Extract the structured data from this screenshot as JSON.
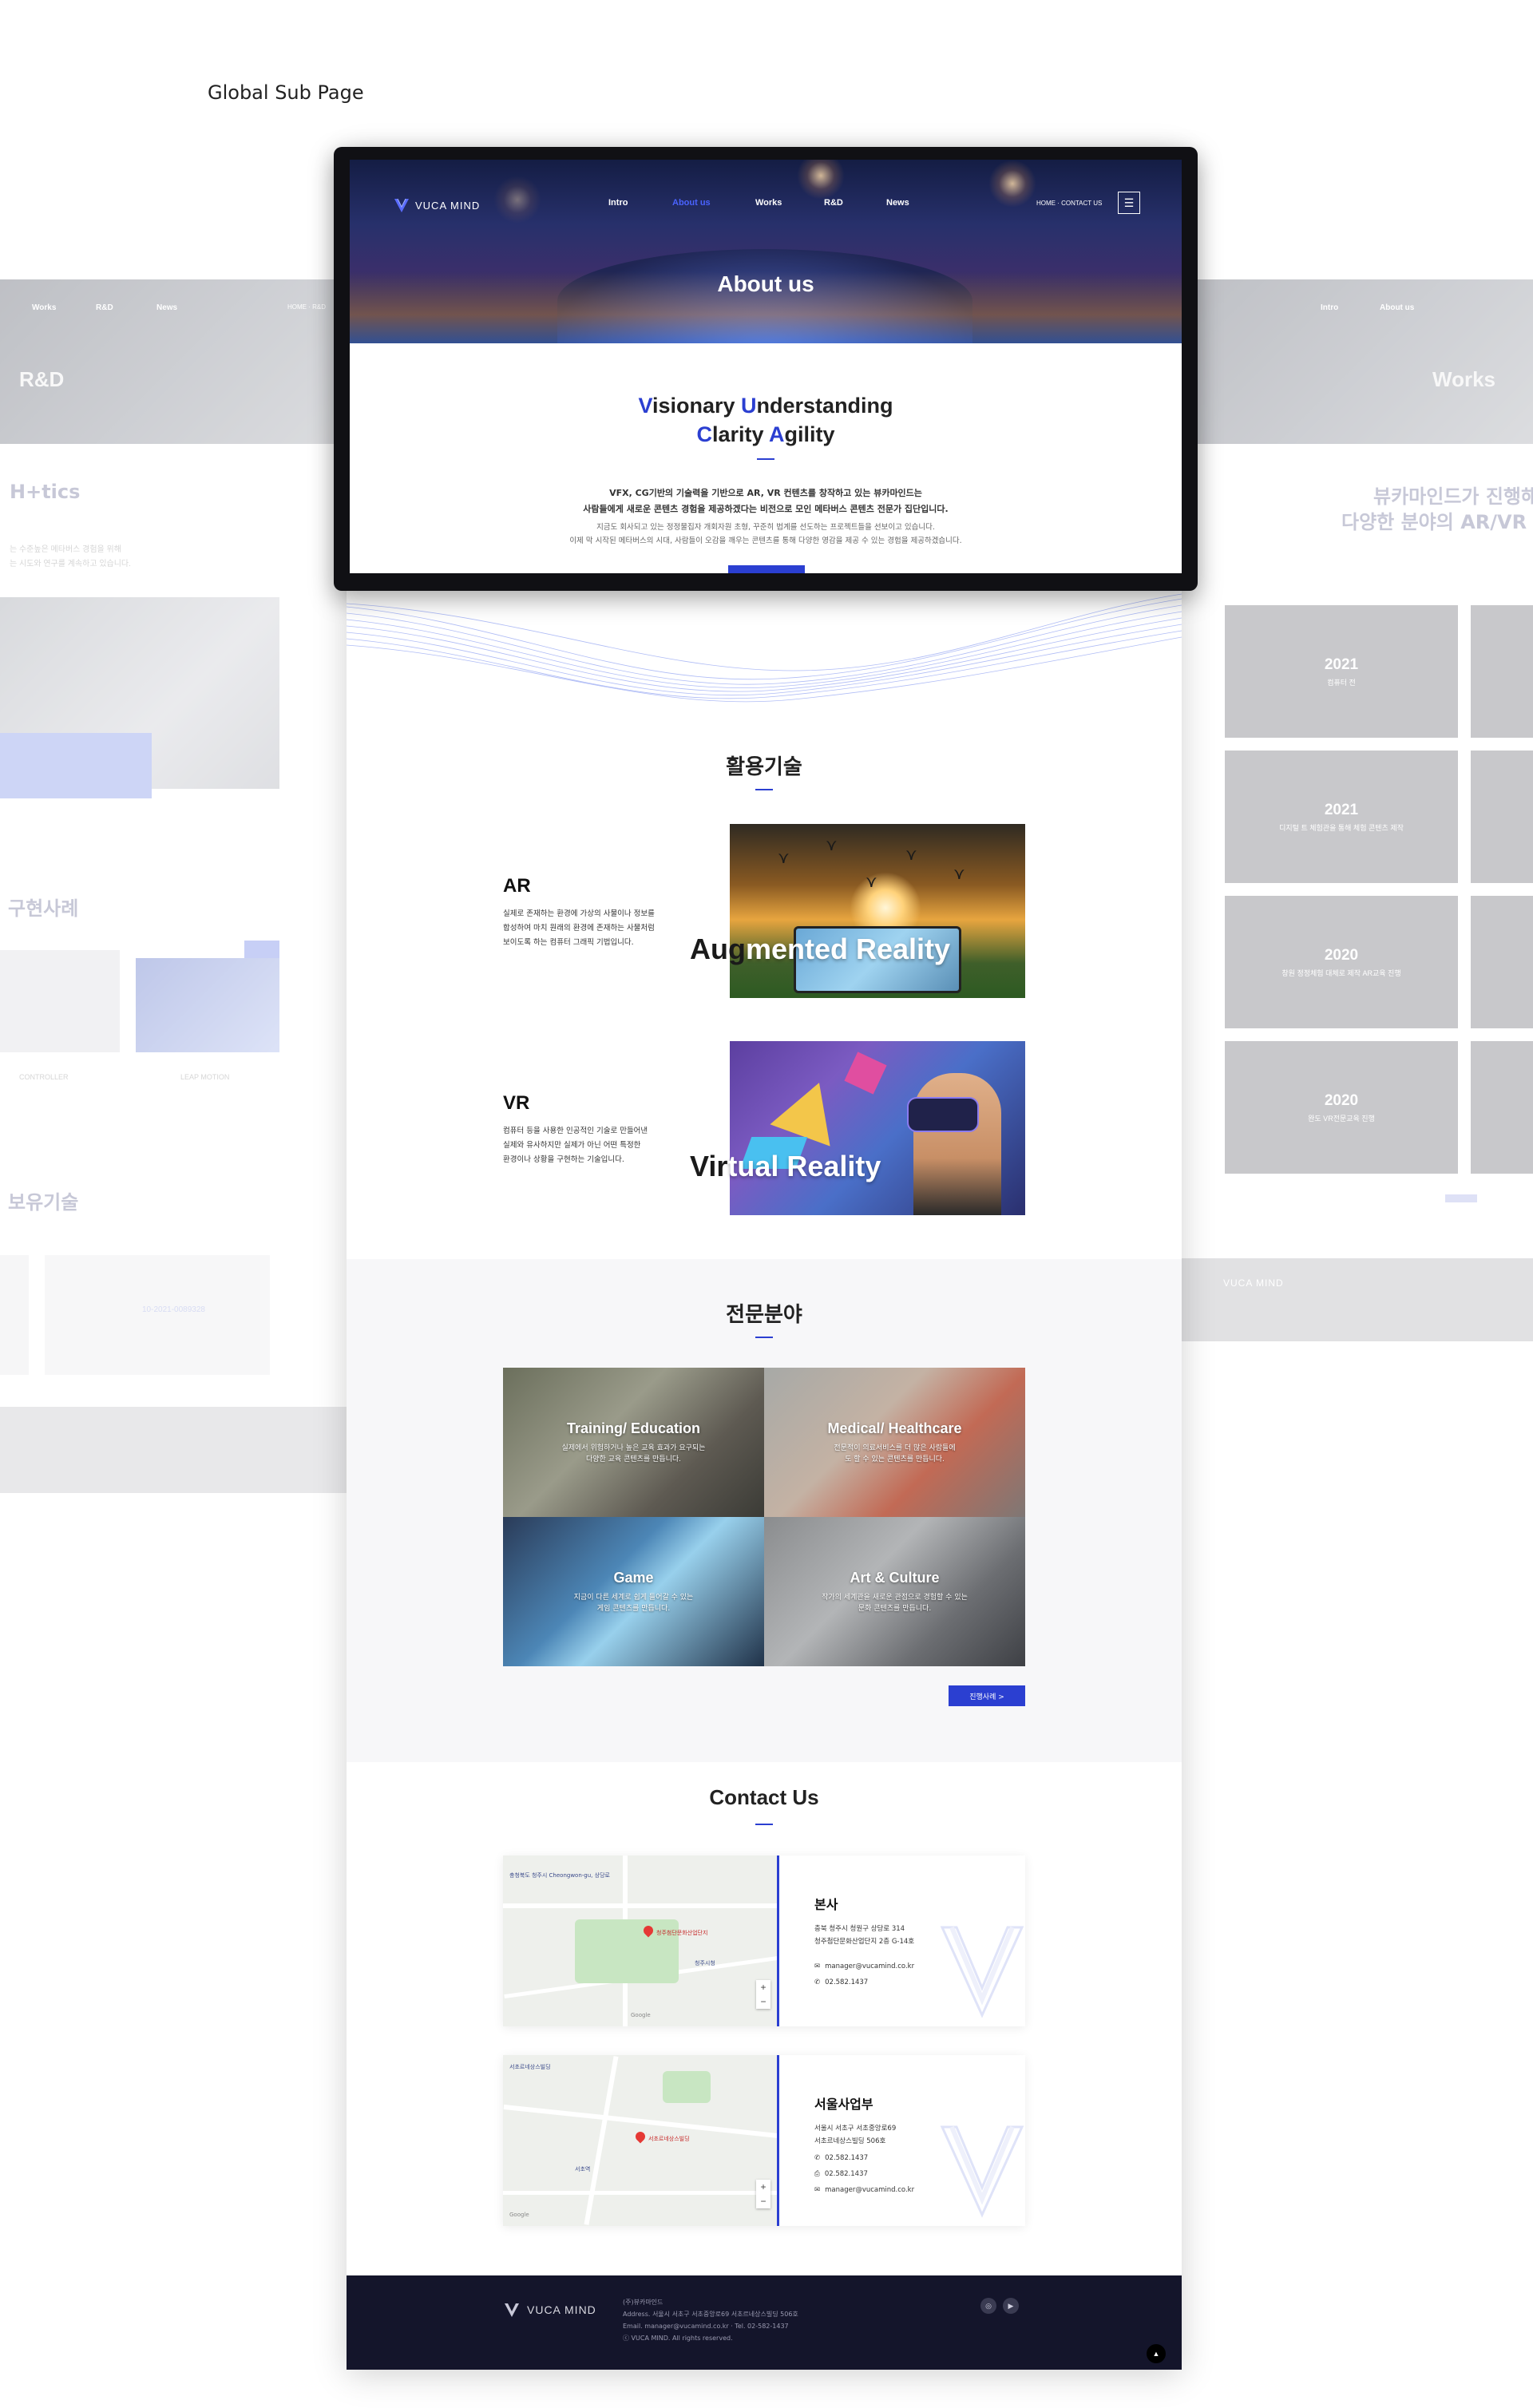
{
  "caption": "Global Sub Page",
  "header": {
    "logo_text": "VUCA MIND",
    "nav": [
      "Intro",
      "About us",
      "Works",
      "R&D",
      "News"
    ],
    "active_nav": "About us",
    "breadcrumb": "HOME · CONTACT US",
    "menu_icon": "hamburger-icon",
    "title": "About us"
  },
  "about": {
    "slogan_line1": [
      "V",
      "isionary ",
      "U",
      "nderstanding"
    ],
    "slogan_line2": [
      "C",
      "larity ",
      "A",
      "gility"
    ],
    "intro_bold": [
      "VFX, CG기반의 기술력을 기반으로 AR, VR 컨텐츠를 창작하고 있는 뷰카마인드는",
      "사람들에게 새로운 콘텐츠 경험을 제공하겠다는 비전으로 모인 메타버스 콘텐츠 전문가 집단입니다."
    ],
    "intro_light": [
      "지금도 회사되고 있는 정정물집자 개회자원 초형, 꾸준히 법계를 선도하는 프로젝트들을 선보이고 있습니다.",
      "이제 막 시작된 메타버스의 시대, 사람들이 오감을 깨우는 콘텐츠를 통해 다양한 영감을 제공 수 있는 경험을 제공하겠습니다."
    ]
  },
  "technology": {
    "title": "활용기술",
    "items": [
      {
        "name": "AR",
        "desc": [
          "실제로 존재하는 환경에 가상의 사물이나 정보를",
          "합성하여 마치 원래의 환경에 존재하는 사물처럼",
          "보이도록 하는 컴퓨터 그래픽 기법입니다."
        ],
        "overlay_dark": "Aug",
        "overlay_light": "mented Reality"
      },
      {
        "name": "VR",
        "desc": [
          "컴퓨터 등을 사용한 인공적인 기술로 만들어낸",
          "실제와 유사하지만 실제가 아닌 어떤 특정한",
          "환경이나 상황을 구현하는 기술입니다."
        ],
        "overlay_dark": "Vir",
        "overlay_light": "tual Reality"
      }
    ]
  },
  "specialty": {
    "title": "전문분야",
    "tiles": [
      {
        "title": "Training/ Education",
        "desc": [
          "실제에서 위험하거나 높은 교육 효과가 요구되는",
          "다양한 교육 콘텐츠를 만듭니다."
        ]
      },
      {
        "title": "Medical/ Healthcare",
        "desc": [
          "전문적이 의료서비스를 더 많은 사람들에",
          "도 할 수 있는 콘텐츠를 만듭니다."
        ]
      },
      {
        "title": "Game",
        "desc": [
          "지금이 다른 세계로 쉽게 들어갈 수 있는",
          "게임 콘텐츠를 만듭니다."
        ]
      },
      {
        "title": "Art & Culture",
        "desc": [
          "작가의 세계관을 새로운 관점으로 경험할 수 있는",
          "문화 콘텐츠를 만듭니다."
        ]
      }
    ],
    "more_label": "진행사례 >"
  },
  "contact": {
    "title": "Contact Us",
    "offices": [
      {
        "name": "본사",
        "address": [
          "충북 청주시 청원구 상당로 314",
          "청주첨단문화산업단지 2층 G-14호"
        ],
        "email": "manager@vucamind.co.kr",
        "phone": "02.582.1437",
        "map_labels": [
          "충청북도 청주시 Cheongwon-gu, 상당로",
          "청주첨단문화산업단지",
          "청주시청",
          "Google"
        ]
      },
      {
        "name": "서울사업부",
        "address": [
          "서울시 서초구 서초중앙로69",
          "서초르네상스빌딩 506호"
        ],
        "phone": "02.582.1437",
        "fax": "02.582.1437",
        "email": "manager@vucamind.co.kr",
        "map_labels": [
          "서초르네상스빌딩",
          "서초르네상스빌딩",
          "서초역",
          "Google"
        ]
      }
    ]
  },
  "footer": {
    "logo_text": "VUCA MIND",
    "info": [
      "(주)뷰카마인드",
      "Address. 서울시 서초구 서초중앙로69 서초르네상스빌딩 506호",
      "Email. manager@vucamind.co.kr  ·  Tel. 02-582-1437",
      "ⓒ VUCA MIND. All rights reserved."
    ],
    "sns": [
      "instagram-icon",
      "youtube-icon"
    ],
    "top_button": "▲"
  },
  "ghost_left": {
    "nav": [
      "Works",
      "R&D",
      "News"
    ],
    "breadcrumb": "HOME · R&D",
    "hero_title": "R&D",
    "sec1": "H+tics",
    "sec1_desc": [
      "는 수준높은 메타버스 경험을 위해",
      "는 시도와 연구를 계속하고 있습니다."
    ],
    "sec2": "구현사례",
    "card_labels": [
      "CONTROLLER",
      "LEAP MOTION"
    ],
    "sec3": "보유기술",
    "patent_no": "10-2021-0089328"
  },
  "ghost_right": {
    "nav": [
      "Intro",
      "About us"
    ],
    "hero_title": "Works",
    "headline1": "뷰카마인드가 진행해",
    "headline2": "다양한 분야의 AR/VR 프",
    "tiles": [
      {
        "year": "2021",
        "sub": "컴퓨터 전"
      },
      {
        "year": "2021",
        "sub": "디지털 트 체험관을 통해 체험 콘텐츠 제작"
      },
      {
        "year": "2020",
        "sub": "창원 정정체험 대체로 제작 AR교육 진행"
      },
      {
        "year": "2020",
        "sub": "완도 VR전문교육 진행"
      }
    ],
    "footer_logo": "VUCA MIND"
  }
}
